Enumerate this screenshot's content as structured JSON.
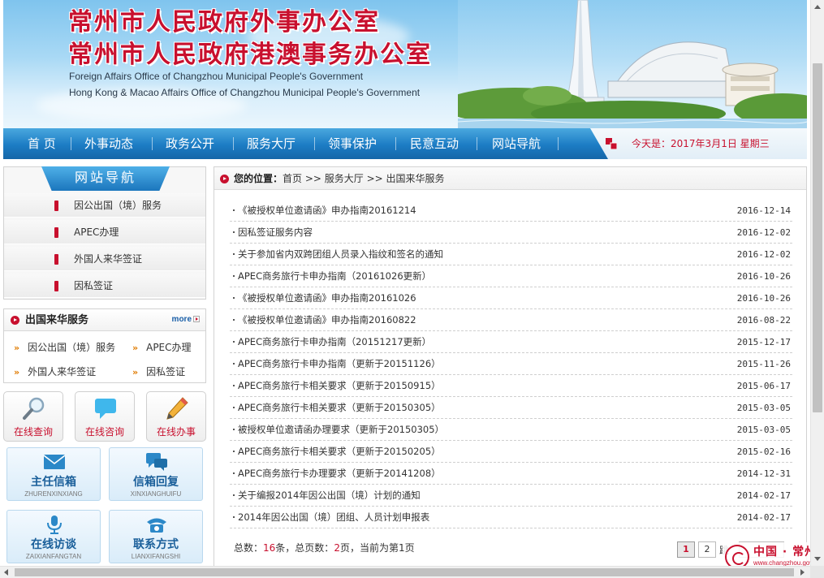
{
  "header": {
    "title_line1": "常州市人民政府外事办公室",
    "title_line2": "常州市人民政府港澳事务办公室",
    "subtitle_line1": "Foreign Affairs Office of Changzhou Municipal People's Government",
    "subtitle_line2": "Hong Kong & Macao Affairs Office of Changzhou Municipal People's Government"
  },
  "nav": {
    "items": [
      "首 页",
      "外事动态",
      "政务公开",
      "服务大厅",
      "领事保护",
      "民意互动",
      "网站导航"
    ],
    "date_label": "今天是：",
    "date_value": "2017年3月1日  星期三"
  },
  "sidebar": {
    "site_nav_title": "网站导航",
    "site_nav_items": [
      "因公出国（境）服务",
      "APEC办理",
      "外国人来华签证",
      "因私签证"
    ],
    "service_box": {
      "title": "出国来华服务",
      "more": "more",
      "links": [
        "因公出国（境）服务",
        "APEC办理",
        "外国人来华签证",
        "因私签证"
      ]
    },
    "quick_buttons": [
      "在线查询",
      "在线咨询",
      "在线办事"
    ],
    "big_buttons": [
      {
        "label": "主任信箱",
        "pinyin": "ZHURENXINXIANG"
      },
      {
        "label": "信箱回复",
        "pinyin": "XINXIANGHUIFU"
      },
      {
        "label": "在线访谈",
        "pinyin": "ZAIXIANFANGTAN"
      },
      {
        "label": "联系方式",
        "pinyin": "LIANXIFANGSHI"
      }
    ]
  },
  "breadcrumb": {
    "label": "您的位置：",
    "path": "首页 >> 服务大厅 >> 出国来华服务"
  },
  "articles": [
    {
      "title": "《被授权单位邀请函》申办指南20161214",
      "date": "2016-12-14"
    },
    {
      "title": "因私签证服务内容",
      "date": "2016-12-02"
    },
    {
      "title": "关于参加省内双跨团组人员录入指纹和签名的通知",
      "date": "2016-12-02"
    },
    {
      "title": "APEC商务旅行卡申办指南（20161026更新）",
      "date": "2016-10-26"
    },
    {
      "title": "《被授权单位邀请函》申办指南20161026",
      "date": "2016-10-26"
    },
    {
      "title": "《被授权单位邀请函》申办指南20160822",
      "date": "2016-08-22"
    },
    {
      "title": "APEC商务旅行卡申办指南（20151217更新）",
      "date": "2015-12-17"
    },
    {
      "title": "APEC商务旅行卡申办指南（更新于20151126）",
      "date": "2015-11-26"
    },
    {
      "title": "APEC商务旅行卡相关要求（更新于20150915）",
      "date": "2015-06-17"
    },
    {
      "title": "APEC商务旅行卡相关要求（更新于20150305）",
      "date": "2015-03-05"
    },
    {
      "title": "被授权单位邀请函办理要求（更新于20150305）",
      "date": "2015-03-05"
    },
    {
      "title": "APEC商务旅行卡相关要求（更新于20150205）",
      "date": "2015-02-16"
    },
    {
      "title": "APEC商务旅行卡办理要求（更新于20141208）",
      "date": "2014-12-31"
    },
    {
      "title": "关于编报2014年因公出国（境）计划的通知",
      "date": "2014-02-17"
    },
    {
      "title": "2014年因公出国（境）团组、人员计划申报表",
      "date": "2014-02-17"
    }
  ],
  "pager": {
    "total_label": "总数：",
    "total": "16",
    "unit1": "条，总页数：",
    "pages": "2",
    "unit2": "页，当前为第1页",
    "page_buttons": [
      "1",
      "2"
    ],
    "jump_label": "跳"
  },
  "logo": {
    "text": "中国 · 常州",
    "url": "www.changzhou.gov.cn"
  },
  "colors": {
    "accent_red": "#c8102e",
    "nav_blue": "#1c7cc4"
  }
}
